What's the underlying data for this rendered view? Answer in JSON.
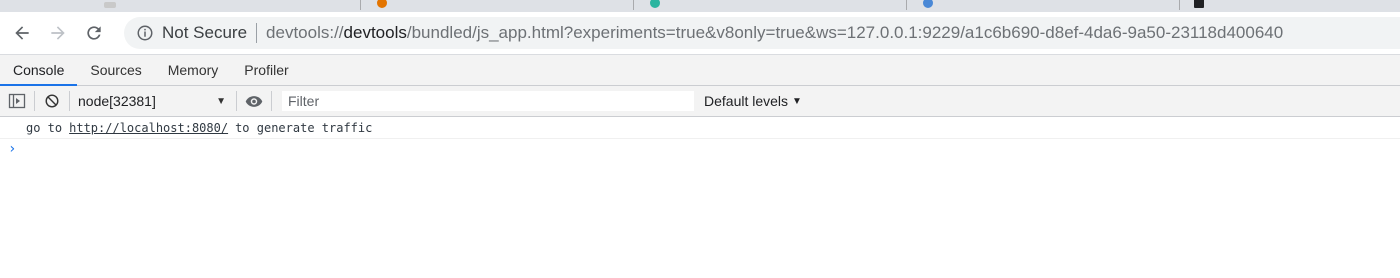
{
  "browser": {
    "security_label": "Not Secure",
    "url": {
      "scheme": "devtools://",
      "host": "devtools",
      "rest": "/bundled/js_app.html?experiments=true&v8only=true&ws=127.0.0.1:9229/a1c6b690-d8ef-4da6-9a50-23118d400640"
    }
  },
  "devtools": {
    "tabs": [
      {
        "label": "Console",
        "active": true
      },
      {
        "label": "Sources",
        "active": false
      },
      {
        "label": "Memory",
        "active": false
      },
      {
        "label": "Profiler",
        "active": false
      }
    ],
    "toolbar": {
      "context": "node[32381]",
      "filter_placeholder": "Filter",
      "filter_value": "",
      "levels_label": "Default levels"
    },
    "console": {
      "message_prefix": "go to",
      "message_link": "http://localhost:8080/",
      "message_suffix": "to generate traffic",
      "prompt_symbol": "›"
    }
  },
  "colors": {
    "accent": "#1a73e8",
    "toolbar_bg": "#f3f3f3",
    "omnibox_bg": "#f1f3f4"
  }
}
